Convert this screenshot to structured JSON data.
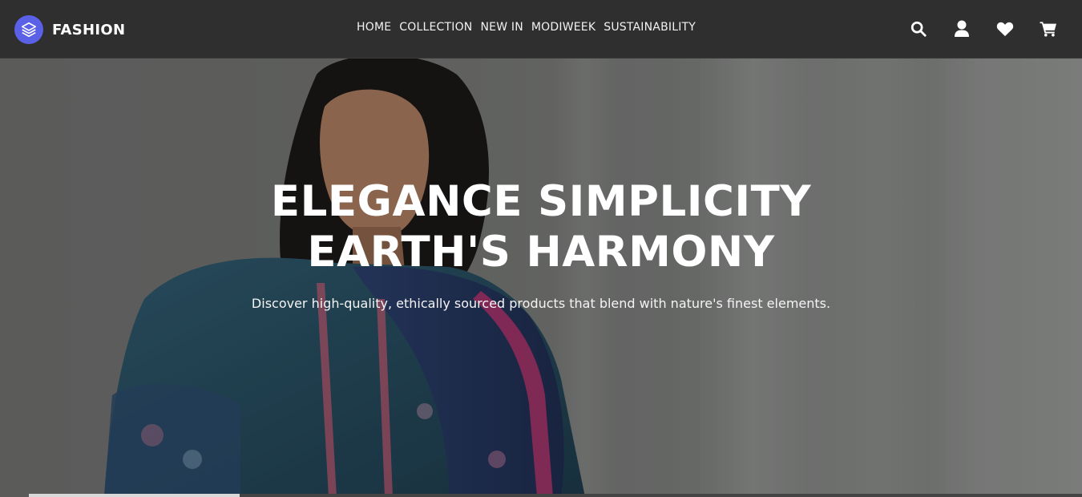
{
  "brand": {
    "name": "FASHION",
    "logo_icon": "layers-icon",
    "logo_color": "#5b61e6"
  },
  "nav": {
    "links": [
      {
        "label": "HOME"
      },
      {
        "label": "COLLECTION"
      },
      {
        "label": "NEW IN"
      },
      {
        "label": "MODIWEEK"
      },
      {
        "label": "SUSTAINABILITY"
      }
    ],
    "icons": [
      "search-icon",
      "user-icon",
      "heart-icon",
      "cart-icon"
    ]
  },
  "hero": {
    "title_line1": "ELEGANCE SIMPLICITY",
    "title_line2": "EARTH'S HARMONY",
    "subtitle": "Discover high-quality, ethically sourced products that blend with nature's finest elements.",
    "slider_progress": 0.2
  },
  "colors": {
    "header_bg": "#2f2f2f",
    "accent": "#5b61e6",
    "text": "#ffffff"
  }
}
